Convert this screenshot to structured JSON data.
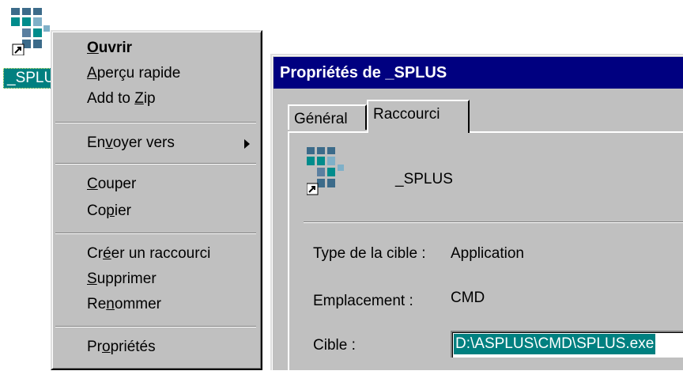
{
  "desktop": {
    "icon": "application-shortcut-icon",
    "label": "_SPLUS"
  },
  "context_menu": {
    "items": [
      {
        "label": "Ouvrir",
        "accel": "O",
        "bold": true
      },
      {
        "label": "Aperçu rapide",
        "accel": "A"
      },
      {
        "label": "Add to Zip",
        "accel": "Z"
      },
      {
        "label": "Envoyer vers",
        "accel": "v",
        "submenu": true
      },
      {
        "label": "Couper",
        "accel": "C"
      },
      {
        "label": "Copier",
        "accel": "p"
      },
      {
        "label": "Créer un raccourci",
        "accel": "é"
      },
      {
        "label": "Supprimer",
        "accel": "S"
      },
      {
        "label": "Renommer",
        "accel": "n"
      },
      {
        "label": "Propriétés",
        "accel": "o"
      }
    ]
  },
  "dialog": {
    "title": "Propriétés de _SPLUS",
    "tabs": [
      "Général",
      "Raccourci"
    ],
    "active_tab": "Raccourci",
    "shortcut_name": "_SPLUS",
    "target_type_label": "Type de la cible :",
    "target_type_value": "Application",
    "location_label": "Emplacement :",
    "location_value": "CMD",
    "target_label": "Cible :",
    "target_value": "D:\\ASPLUS\\CMD\\SPLUS.exe"
  },
  "colors": {
    "menu_bg": "#c0c0c0",
    "title_bar": "#000080",
    "selection": "#008080"
  }
}
